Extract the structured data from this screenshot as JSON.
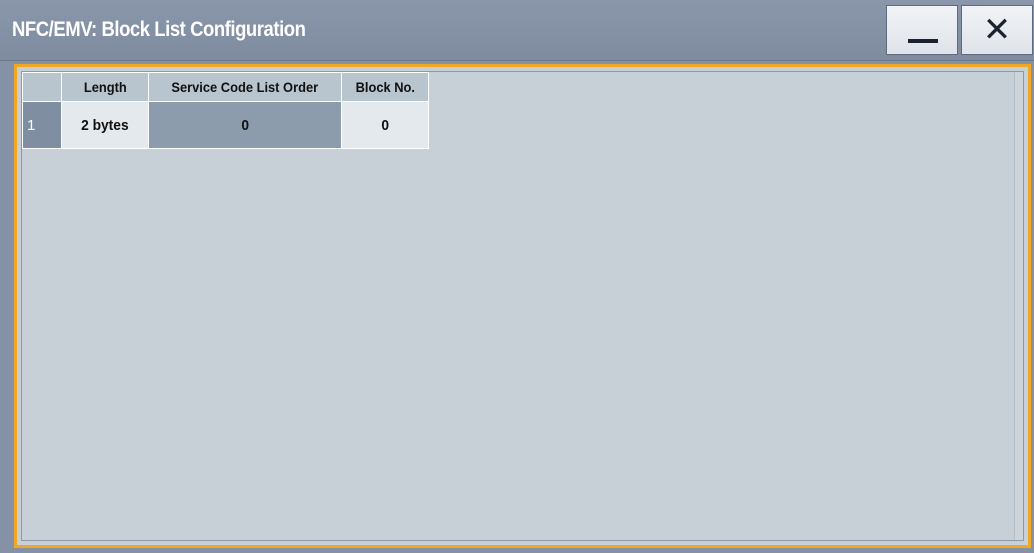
{
  "window": {
    "title": "NFC/EMV: Block List Configuration",
    "minimize_icon": "minimize-icon",
    "close_icon": "close-icon",
    "close_glyph": "✕"
  },
  "colors": {
    "titlebar": "#8592a5",
    "focus_border": "#f0a824",
    "content_bg": "#c6d0d6"
  },
  "table": {
    "columns": [
      "",
      "Length",
      "Service Code List Order",
      "Block No."
    ],
    "rows": [
      {
        "index": "1",
        "length": "2 bytes",
        "service_code_list_order": "0",
        "block_no": "0"
      }
    ]
  }
}
